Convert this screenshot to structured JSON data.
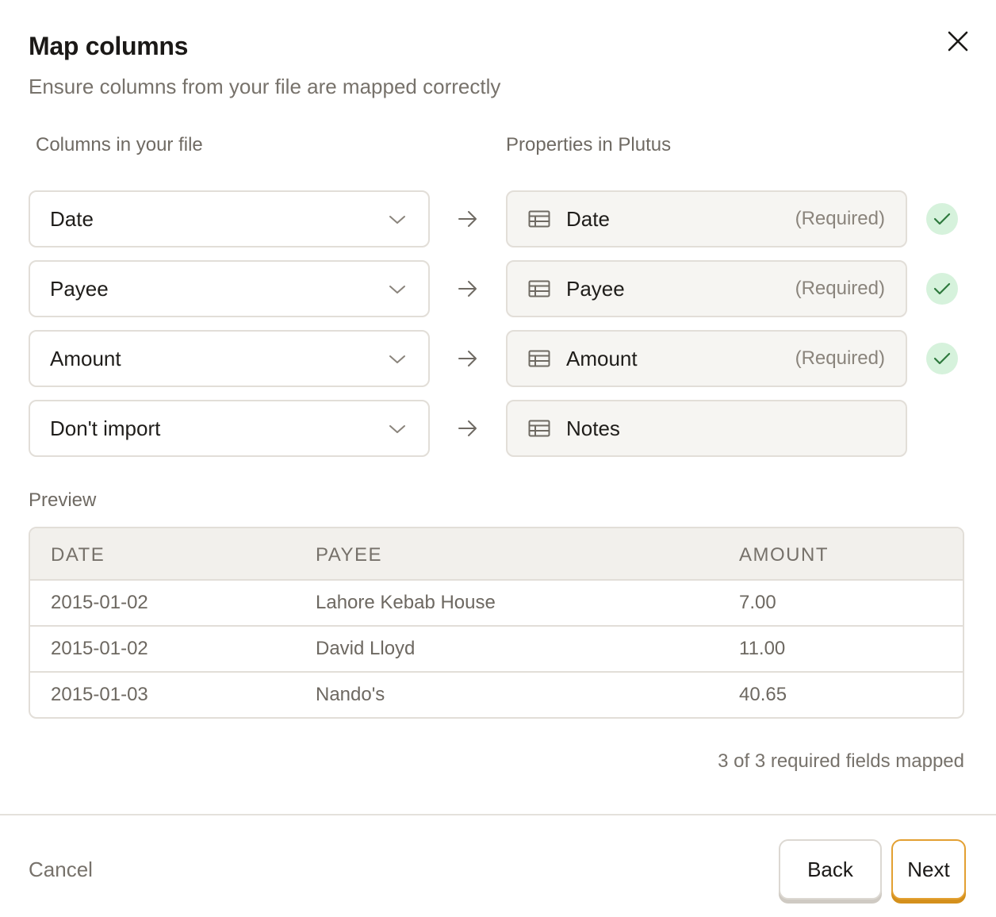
{
  "dialog": {
    "title": "Map columns",
    "subtitle": "Ensure columns from your file are mapped correctly",
    "close_icon": "close-icon"
  },
  "columns": {
    "left_header": "Columns in your file",
    "right_header": "Properties in Plutus"
  },
  "mappings": [
    {
      "source": "Date",
      "property": "Date",
      "required": "(Required)",
      "mapped": true
    },
    {
      "source": "Payee",
      "property": "Payee",
      "required": "(Required)",
      "mapped": true
    },
    {
      "source": "Amount",
      "property": "Amount",
      "required": "(Required)",
      "mapped": true
    },
    {
      "source": "Don't import",
      "property": "Notes",
      "required": "",
      "mapped": false
    }
  ],
  "preview": {
    "label": "Preview",
    "headers": [
      "DATE",
      "PAYEE",
      "AMOUNT"
    ],
    "rows": [
      [
        "2015-01-02",
        "Lahore Kebab House",
        "7.00"
      ],
      [
        "2015-01-02",
        "David Lloyd",
        "11.00"
      ],
      [
        "2015-01-03",
        "Nando's",
        "40.65"
      ]
    ]
  },
  "summary": "3 of 3 required fields mapped",
  "footer": {
    "cancel_label": "Cancel",
    "back_label": "Back",
    "next_label": "Next"
  },
  "colors": {
    "accent": "#e3a032",
    "success_bg": "#d6f2dc",
    "success_check": "#2f7a3e"
  }
}
